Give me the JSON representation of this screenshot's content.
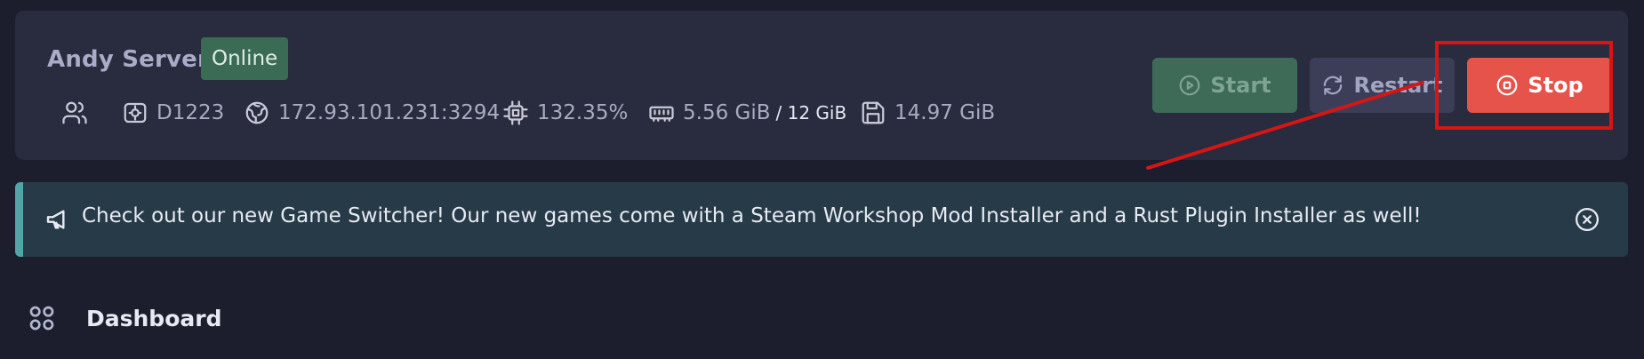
{
  "server": {
    "name": "Andy Server",
    "status": "Online",
    "stats": {
      "users_icon": "users-icon",
      "node": "D1223",
      "address": "172.93.101.231:3294",
      "cpu": "132.35%",
      "memory_used": "5.56 GiB",
      "memory_total": "/ 12 GiB",
      "disk": "14.97 GiB"
    }
  },
  "actions": {
    "start_label": "Start",
    "restart_label": "Restart",
    "stop_label": "Stop"
  },
  "announcement": {
    "text": "Check out our new Game Switcher! Our new games come with a Steam Workshop Mod Installer and a Rust Plugin Installer as well!"
  },
  "nav": {
    "dashboard_label": "Dashboard"
  },
  "colors": {
    "background": "#1c1e2e",
    "card": "#292b3e",
    "online": "#3b6a55",
    "start": "#3e6b58",
    "restart": "#3c3e58",
    "stop": "#e5534b",
    "annotation": "#d81515",
    "announcement": "#263a48",
    "accent": "#4fa5a8"
  }
}
